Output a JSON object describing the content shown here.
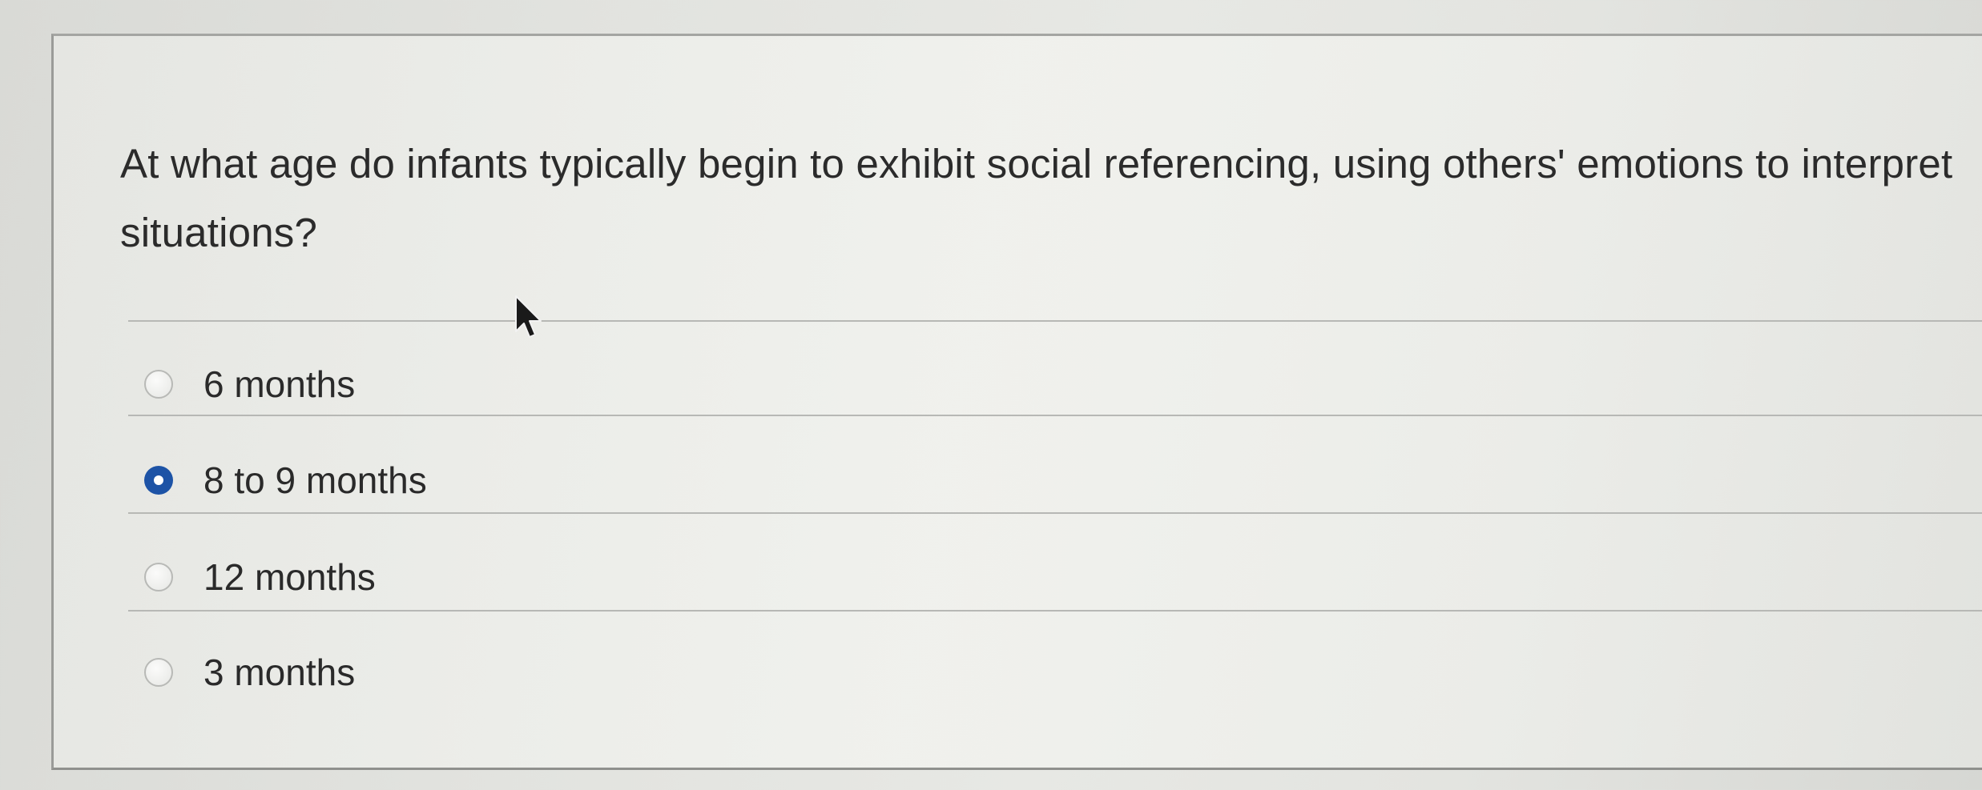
{
  "question": {
    "text": "At what age do infants typically begin to exhibit social referencing, using others' emotions to interpret situations?"
  },
  "options": [
    {
      "label": "6 months",
      "selected": false
    },
    {
      "label": "8 to 9 months",
      "selected": true
    },
    {
      "label": "12 months",
      "selected": false
    },
    {
      "label": "3 months",
      "selected": false
    }
  ],
  "colors": {
    "radio_selected": "#1d53a6",
    "text": "#2a2a2a",
    "divider": "#b7b8b5"
  },
  "icons": {
    "cursor": "mouse-pointer-icon"
  }
}
